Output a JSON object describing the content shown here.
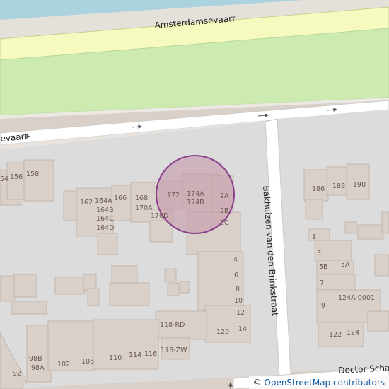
{
  "map": {
    "street_names": {
      "amsterdamsevaart": "Amsterdamsevaart",
      "amsterdamsevaart_partial": "evaart",
      "bakhuizen": "Bakhuizen van den Brinkstraat",
      "doctor": "Doctor Schae"
    },
    "house_numbers": {
      "n154": "54",
      "n156": "156",
      "n158": "158",
      "n162": "162",
      "n164a": "164A",
      "n164b": "164B",
      "n164c": "164C",
      "n164d": "164D",
      "n166": "166",
      "n168": "168",
      "n170a": "170A",
      "n170d": "170D",
      "n172": "172",
      "n174a": "174A",
      "n174b": "174B",
      "n2a": "2A",
      "n2b": "2B",
      "n2c": "2C",
      "n4": "4",
      "n6": "6",
      "n8": "8",
      "n10": "10",
      "n12": "12",
      "n14": "14",
      "n120": "120",
      "n118rd": "118-RD",
      "n118zw": "118-ZW",
      "n116": "116",
      "n114": "114",
      "n110": "110",
      "n106": "106",
      "n102": "102",
      "n98b": "98B",
      "n98a": "98A",
      "n92": "92",
      "n186": "186",
      "n188": "188",
      "n190": "190",
      "n1": "1",
      "n3": "3",
      "n5b": "5B",
      "n5a": "5A",
      "n7": "7",
      "n9": "9",
      "n124a0001": "124A-0001",
      "n122": "122",
      "n124": "124"
    },
    "highlight_color": "#8a3c8c",
    "attribution": {
      "symbol": "©",
      "link": "OpenStreetMap contributors"
    }
  }
}
